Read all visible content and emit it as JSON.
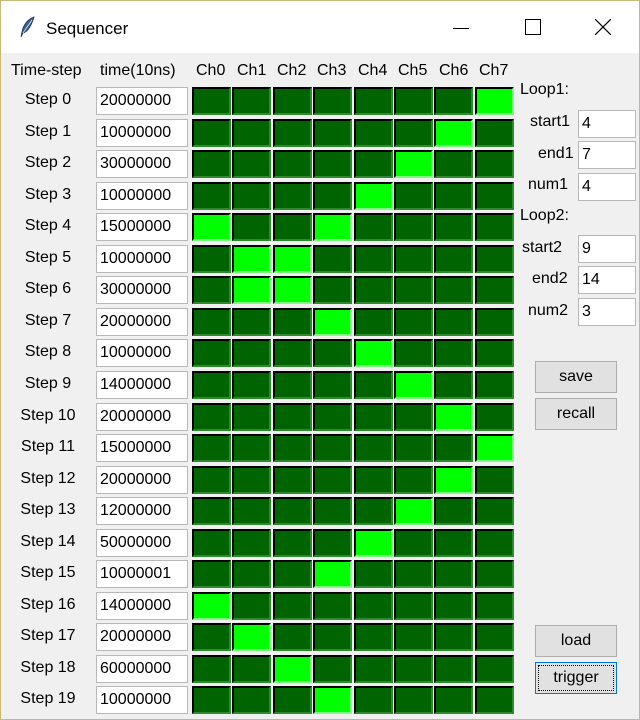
{
  "window": {
    "title": "Sequencer",
    "icon": "feather-icon",
    "controls": [
      "minimize-icon",
      "maximize-icon",
      "close-icon"
    ]
  },
  "header": {
    "time_step": "Time-step",
    "time": "time(10ns)",
    "channels": [
      "Ch0",
      "Ch1",
      "Ch2",
      "Ch3",
      "Ch4",
      "Ch5",
      "Ch6",
      "Ch7"
    ]
  },
  "colors": {
    "cell_off": "#006400",
    "cell_on": "#00ff00"
  },
  "steps": [
    {
      "label": "Step 0",
      "time": "20000000",
      "on": [
        7
      ]
    },
    {
      "label": "Step 1",
      "time": "10000000",
      "on": [
        6
      ]
    },
    {
      "label": "Step 2",
      "time": "30000000",
      "on": [
        5
      ]
    },
    {
      "label": "Step 3",
      "time": "10000000",
      "on": [
        4
      ]
    },
    {
      "label": "Step 4",
      "time": "15000000",
      "on": [
        0,
        3
      ]
    },
    {
      "label": "Step 5",
      "time": "10000000",
      "on": [
        1,
        2
      ]
    },
    {
      "label": "Step 6",
      "time": "30000000",
      "on": [
        1,
        2
      ]
    },
    {
      "label": "Step 7",
      "time": "20000000",
      "on": [
        3
      ]
    },
    {
      "label": "Step 8",
      "time": "10000000",
      "on": [
        4
      ]
    },
    {
      "label": "Step 9",
      "time": "14000000",
      "on": [
        5
      ]
    },
    {
      "label": "Step 10",
      "time": "20000000",
      "on": [
        6
      ]
    },
    {
      "label": "Step 11",
      "time": "15000000",
      "on": [
        7
      ]
    },
    {
      "label": "Step 12",
      "time": "20000000",
      "on": [
        6
      ]
    },
    {
      "label": "Step 13",
      "time": "12000000",
      "on": [
        5
      ]
    },
    {
      "label": "Step 14",
      "time": "50000000",
      "on": [
        4
      ]
    },
    {
      "label": "Step 15",
      "time": "10000001",
      "on": [
        3
      ]
    },
    {
      "label": "Step 16",
      "time": "14000000",
      "on": [
        0
      ]
    },
    {
      "label": "Step 17",
      "time": "20000000",
      "on": [
        1
      ]
    },
    {
      "label": "Step 18",
      "time": "60000000",
      "on": [
        2
      ]
    },
    {
      "label": "Step 19",
      "time": "10000000",
      "on": [
        3
      ]
    }
  ],
  "loop1": {
    "title": "Loop1:",
    "start_label": "start1",
    "start_value": "4",
    "end_label": "end1",
    "end_value": "7",
    "num_label": "num1",
    "num_value": "4"
  },
  "loop2": {
    "title": "Loop2:",
    "start_label": "start2",
    "start_value": "9",
    "end_label": "end2",
    "end_value": "14",
    "num_label": "num2",
    "num_value": "3"
  },
  "buttons": {
    "save": "save",
    "recall": "recall",
    "load": "load",
    "trigger": "trigger"
  }
}
